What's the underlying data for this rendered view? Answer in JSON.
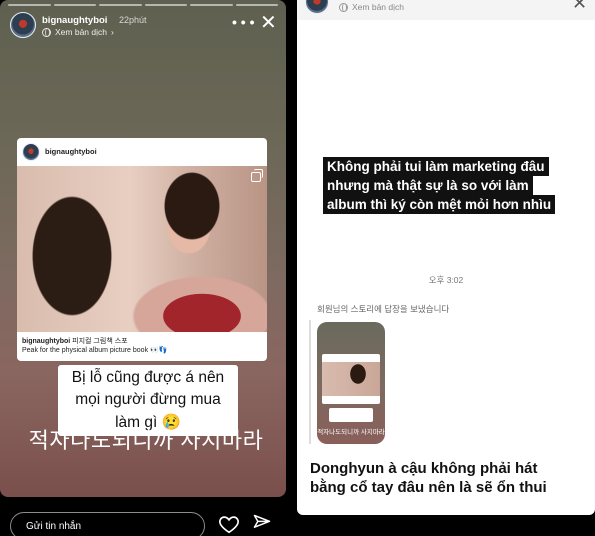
{
  "left_story": {
    "username": "bignaughtyboi",
    "time": "22phút",
    "translate_label": "Xem bản dịch",
    "more_icon": "more-horizontal-icon",
    "close_icon": "close-icon",
    "post": {
      "username": "bignaughtyboi",
      "caption_user": "bignaughtyboi",
      "caption_korean": "피지컬 그림책 스포",
      "caption_english": "Peak for the physical album picture book 👀👣"
    },
    "sticker_text": "Bị lỗ cũng được á nên mọi người đừng mua làm gì 😢",
    "korean_text": "적자나도되니까 사지마라",
    "reply_placeholder": "Gửi tin nhắn"
  },
  "right_story": {
    "translate_label": "Xem bản dịch",
    "black_lines": [
      "Không phải tui làm marketing đâu",
      "nhưng mà thật sự là so với làm",
      "album thì ký còn mệt mỏi hơn nhìu"
    ],
    "timestamp": "오후 3:02",
    "reply_note": "회원님의 스토리에 답장을 보냈습니다",
    "mini_korean": "적자나도되니까 사지마라",
    "bottom_lines": [
      "Donghyun à cậu không phải hát",
      "bằng cổ tay đâu nên là sẽ ổn thui"
    ]
  },
  "colors": {
    "background": "#000000",
    "sticker_bg": "#ffffff",
    "black_label_bg": "#111111"
  }
}
